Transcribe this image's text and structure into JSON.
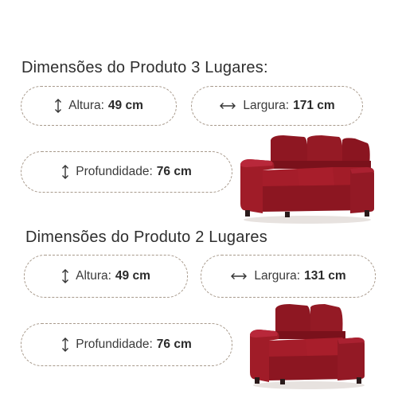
{
  "section_3": {
    "title": "Dimensões do Produto 3 Lugares:",
    "height": {
      "label": "Altura:",
      "value": "49 cm",
      "icon": "vertical-arrow-icon"
    },
    "width": {
      "label": "Largura:",
      "value": "171 cm",
      "icon": "horizontal-arrow-icon"
    },
    "depth": {
      "label": "Profundidade:",
      "value": "76 cm",
      "icon": "vertical-arrow-icon"
    }
  },
  "section_2": {
    "title": "Dimensões do Produto 2 Lugares",
    "height": {
      "label": "Altura:",
      "value": "49 cm",
      "icon": "vertical-arrow-icon"
    },
    "width": {
      "label": "Largura:",
      "value": "131 cm",
      "icon": "horizontal-arrow-icon"
    },
    "depth": {
      "label": "Profundidade:",
      "value": "76 cm",
      "icon": "vertical-arrow-icon"
    }
  },
  "colors": {
    "sofa": "#9e1a26",
    "sofa_dark": "#6e0f18",
    "border": "#a89a8c"
  }
}
